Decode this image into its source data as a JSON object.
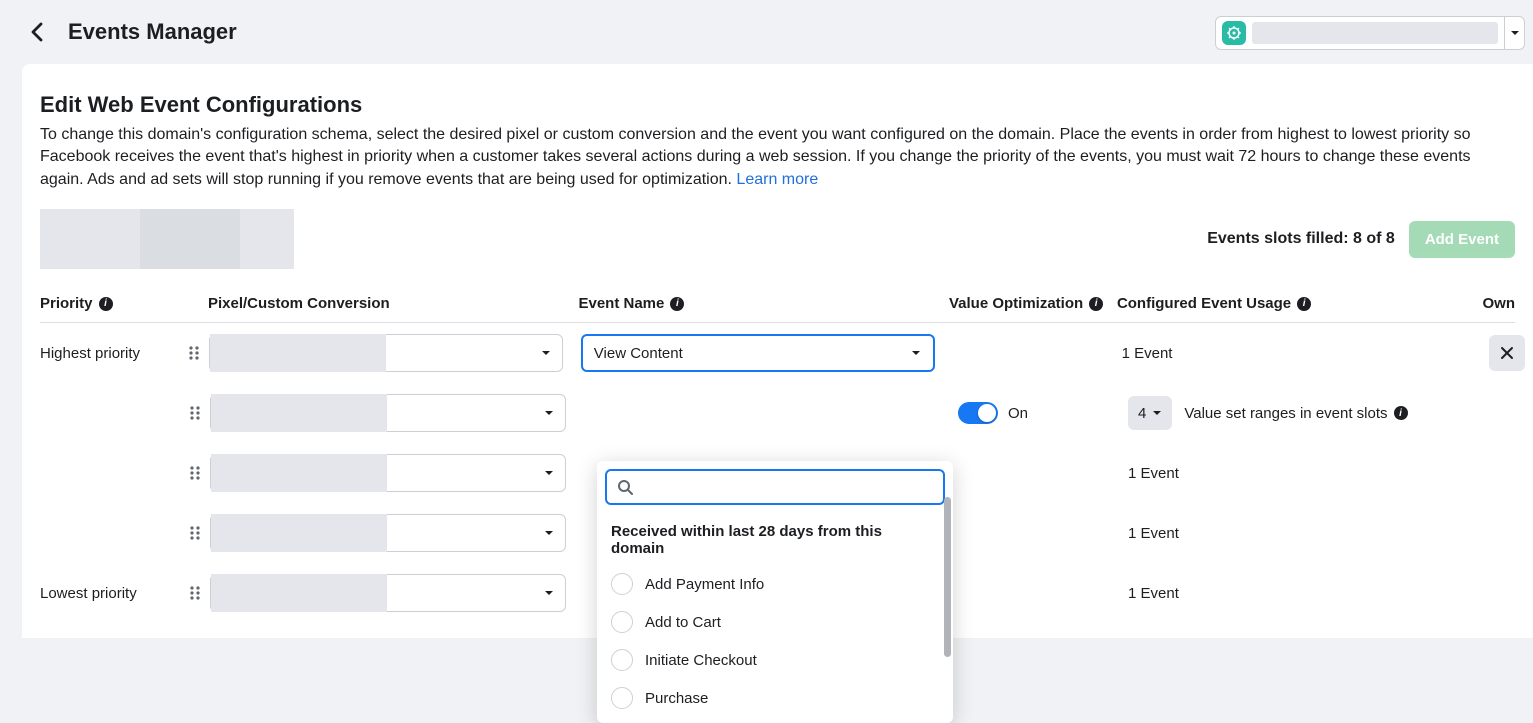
{
  "header": {
    "title": "Events Manager"
  },
  "panel": {
    "heading": "Edit Web Event Configurations",
    "description": "To change this domain's configuration schema, select the desired pixel or custom conversion and the event you want configured on the domain. Place the events in order from highest to lowest priority so Facebook receives the event that's highest in priority when a customer takes several actions during a web session. If you change the priority of the events, you must wait 72 hours to change these events again. Ads and ad sets will stop running if you remove events that are being used for optimization.",
    "learn_more": "Learn more",
    "slots_filled": "Events slots filled: 8 of 8",
    "add_event": "Add Event"
  },
  "columns": {
    "priority": "Priority",
    "pixel": "Pixel/Custom Conversion",
    "event_name": "Event Name",
    "value_optimization": "Value Optimization",
    "configured_usage": "Configured Event Usage",
    "owner": "Own"
  },
  "rows": [
    {
      "priority_label": "Highest priority",
      "event": "View Content",
      "configured": "1 Event",
      "has_delete": true,
      "active_select": true
    },
    {
      "priority_label": "",
      "event": "",
      "configured": "",
      "toggle_on": "On",
      "value_count": "4",
      "value_ranges": "Value set ranges in event slots"
    },
    {
      "priority_label": "",
      "event": "",
      "configured": "1 Event"
    },
    {
      "priority_label": "",
      "event": "",
      "configured": "1 Event"
    },
    {
      "priority_label": "Lowest priority",
      "event": "",
      "configured": "1 Event"
    }
  ],
  "dropdown": {
    "section_title": "Received within last 28 days from this domain",
    "options": [
      "Add Payment Info",
      "Add to Cart",
      "Initiate Checkout",
      "Purchase"
    ],
    "search_placeholder": ""
  }
}
